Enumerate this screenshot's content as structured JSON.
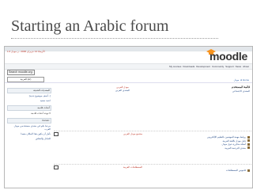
{
  "slide": {
    "title": "Starting an Arabic forum"
  },
  "browser": {
    "date_text": "الأربعاء 14 حزيران 2006 - ن مودل 1.6",
    "logo_text": "moodle",
    "nav_items": [
      "My courses",
      "Downloads",
      "Development",
      "Community",
      "Support",
      "News",
      "About"
    ],
    "search_label": "Search moodle.org:",
    "language_select": "العربية (ar)",
    "breadcrumb": "مودل ◄ Home"
  },
  "left_blocks": [
    {
      "title": "المنتديات الحديثة",
      "lines": [
        "[أضف موضوع جديد...]",
        "احمد سعيد"
      ],
      "dark": false
    },
    {
      "title": "أحداث قادمة",
      "lines": [
        "لا توجد أحداث قادمة"
      ],
      "dark": true
    },
    {
      "title": "Forum:",
      "lines": [
        "مرحبا بكم في منتدى مستخدمي مودل العرب",
        "نأمل أن يكون هذا المكان مفيدا",
        "للتبادل والنقاش"
      ],
      "dark": false
    }
  ],
  "main": {
    "heading": "مودل العربي",
    "subheading": "المنتدى العربي"
  },
  "right_col": {
    "title": "قائمة المستخدم",
    "links": [
      "المنتدى الاجتماعي"
    ]
  },
  "sections": [
    {
      "title": "مجتمع مودل العربي",
      "items": [
        "روابط مهمة للمهتمين بالتعليم الإلكتروني",
        "دليل مودل باللغة العربية",
        "أسئلة متكررة حول مودل",
        "منتدى الترجمة العربية"
      ]
    },
    {
      "title": "المصطلحات العربية",
      "items": [
        "قاموس المصطلحات"
      ]
    }
  ]
}
